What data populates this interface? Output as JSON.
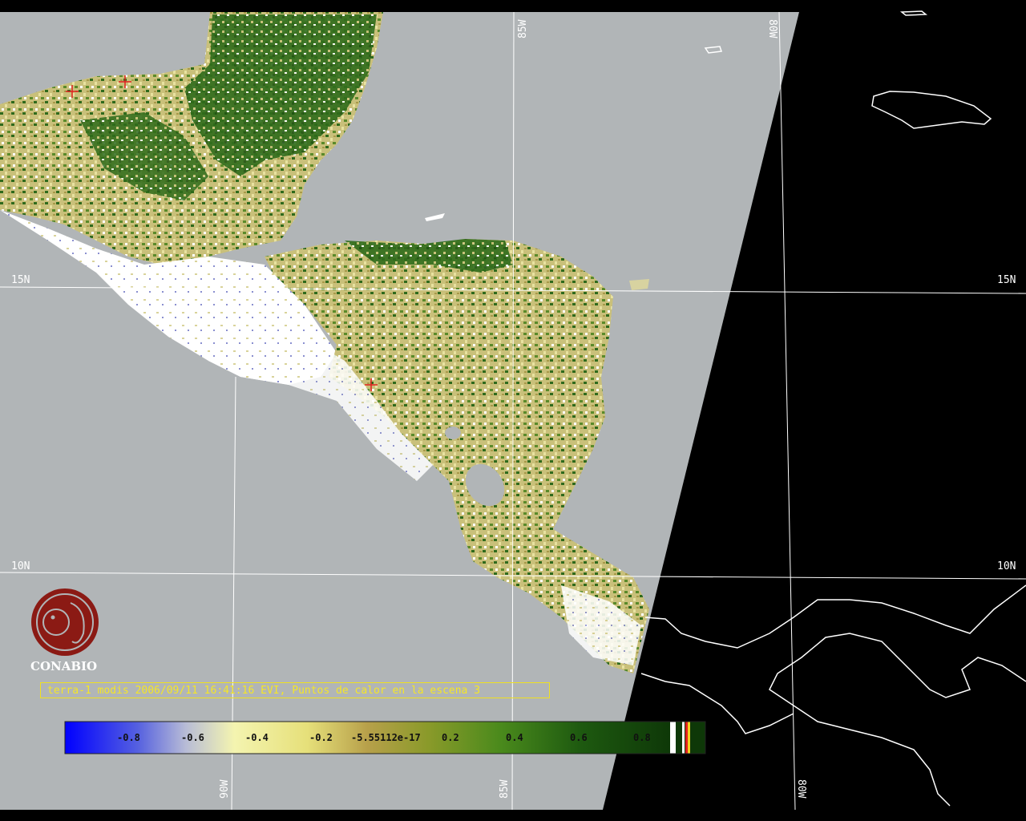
{
  "map": {
    "caption": "terra-1 modis 2006/09/11 16:41:16 EVI, Puntos de calor en la escena 3",
    "logo": {
      "text": "CONABIO",
      "icon": "conabio-parrot-logo"
    },
    "grid_labels": {
      "lat_15_left": "15N",
      "lat_15_right": "15N",
      "lat_10_left": "10N",
      "lat_10_right": "10N",
      "lon_85_top": "85W",
      "lon_80_top": "80W",
      "lon_90_bottom": "90W",
      "lon_85_bottom": "85W",
      "lon_80_bottom": "80W"
    },
    "hotspots": [
      {
        "name": "hotspot-yucatan-west"
      },
      {
        "name": "hotspot-yucatan-north"
      },
      {
        "name": "hotspot-el-salvador"
      }
    ],
    "colors": {
      "ocean": "#b1b5b7",
      "nodata": "#000000",
      "grid": "#ffffff",
      "hotspot": "#e02020",
      "caption": "#f0e020",
      "logo": "#8b1a14"
    },
    "color_scale": {
      "labels": [
        "-0.8",
        "-0.6",
        "-0.4",
        "-0.2",
        "-5.55112e-17",
        "0.2",
        "0.4",
        "0.6",
        "0.8"
      ]
    }
  }
}
